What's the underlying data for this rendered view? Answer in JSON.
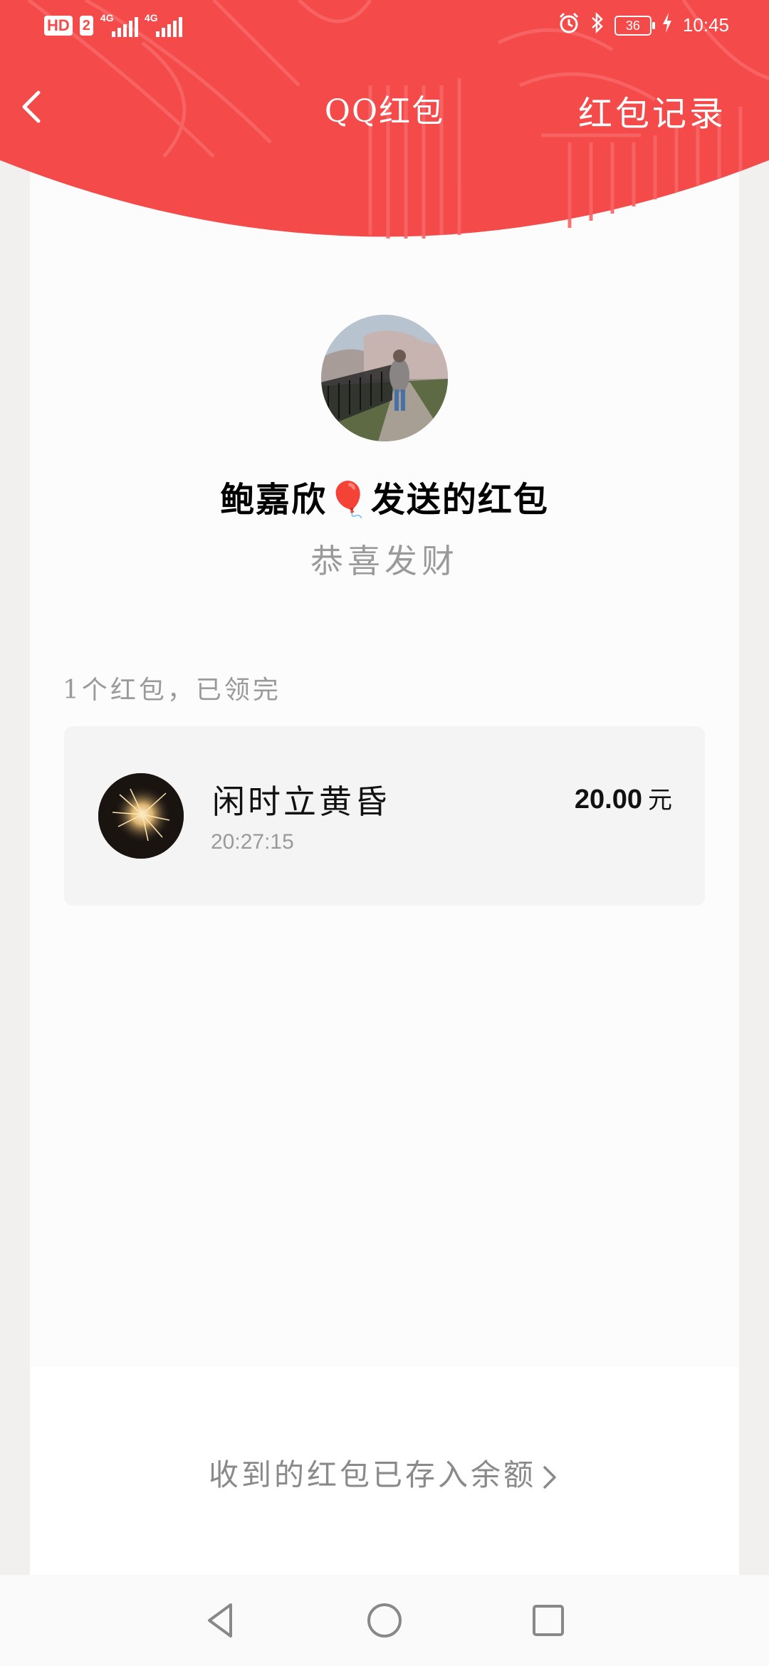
{
  "status_bar": {
    "hd_label": "HD",
    "sim_label": "2",
    "network_1": "4G",
    "network_2": "4G",
    "battery": "36",
    "time": "10:45"
  },
  "nav": {
    "title": "QQ红包",
    "records_label": "红包记录"
  },
  "sender": {
    "name": "鲍嘉欣🎈发送的红包",
    "blessing": "恭喜发财"
  },
  "summary": "1个红包，已领完",
  "records": [
    {
      "name": "闲时立黄昏",
      "time": "20:27:15",
      "amount": "20.00",
      "unit": "元"
    }
  ],
  "footer": {
    "balance_text": "收到的红包已存入余额"
  },
  "colors": {
    "header_red": "#f44a4a",
    "header_red_light": "#f86060",
    "card_bg": "#fcfcfc",
    "muted_text": "#9a9a9a"
  },
  "icons": {
    "back": "chevron-left-icon",
    "alarm": "alarm-icon",
    "bluetooth": "bluetooth-icon",
    "charging": "charging-bolt-icon",
    "balance_arrow": "chevron-right-icon",
    "nav_back": "triangle-back-icon",
    "nav_home": "circle-home-icon",
    "nav_recent": "square-recent-icon"
  }
}
